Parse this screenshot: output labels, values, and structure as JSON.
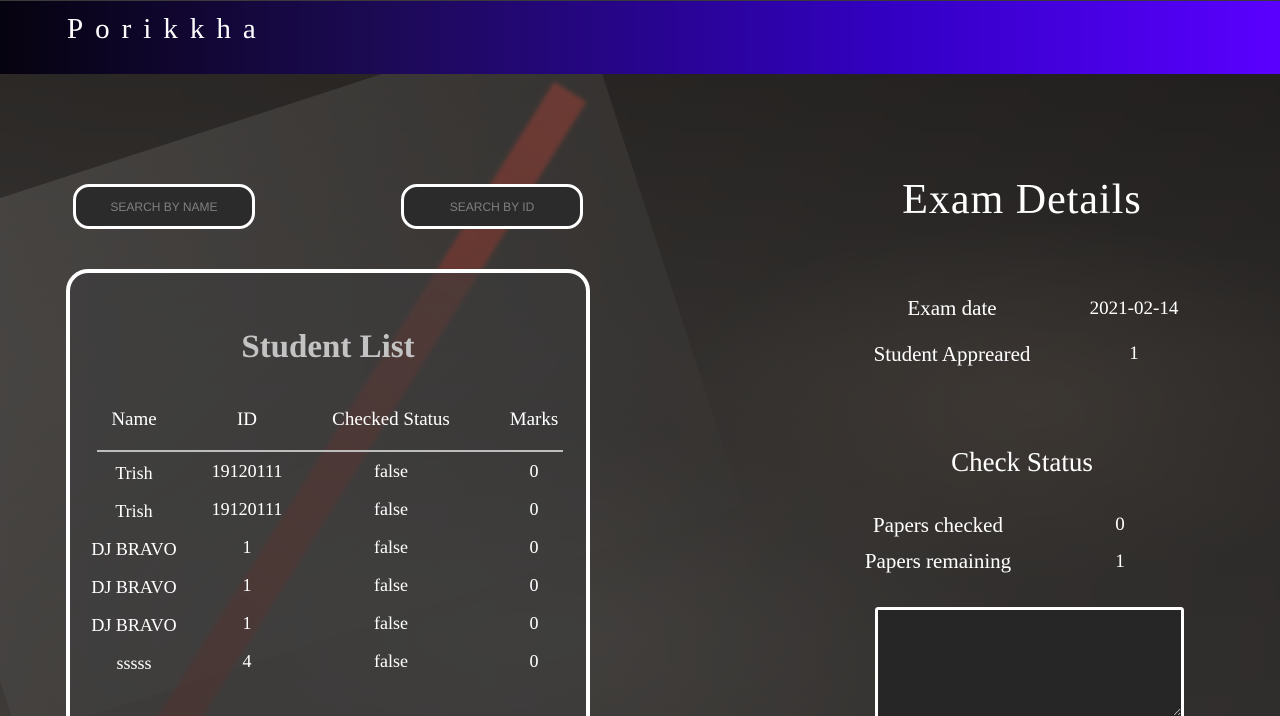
{
  "navbar": {
    "brand": "Porikkha"
  },
  "search": {
    "name_placeholder": "SEARCH BY NAME",
    "id_placeholder": "SEARCH BY ID"
  },
  "student_list": {
    "title": "Student List",
    "columns": [
      "Name",
      "ID",
      "Checked Status",
      "Marks"
    ],
    "rows": [
      [
        "Trish",
        "19120111",
        "false",
        "0"
      ],
      [
        "Trish",
        "19120111",
        "false",
        "0"
      ],
      [
        "DJ BRAVO",
        "1",
        "false",
        "0"
      ],
      [
        "DJ BRAVO",
        "1",
        "false",
        "0"
      ],
      [
        "DJ BRAVO",
        "1",
        "false",
        "0"
      ],
      [
        "sssss",
        "4",
        "false",
        "0"
      ]
    ]
  },
  "exam_details": {
    "title": "Exam Details",
    "exam_date_label": "Exam date",
    "exam_date": "2021-02-14",
    "appeared_label": "Student Appreared",
    "appeared": "1"
  },
  "check_status": {
    "title": "Check Status",
    "checked_label": "Papers checked",
    "checked": "0",
    "remaining_label": "Papers remaining",
    "remaining": "1"
  }
}
